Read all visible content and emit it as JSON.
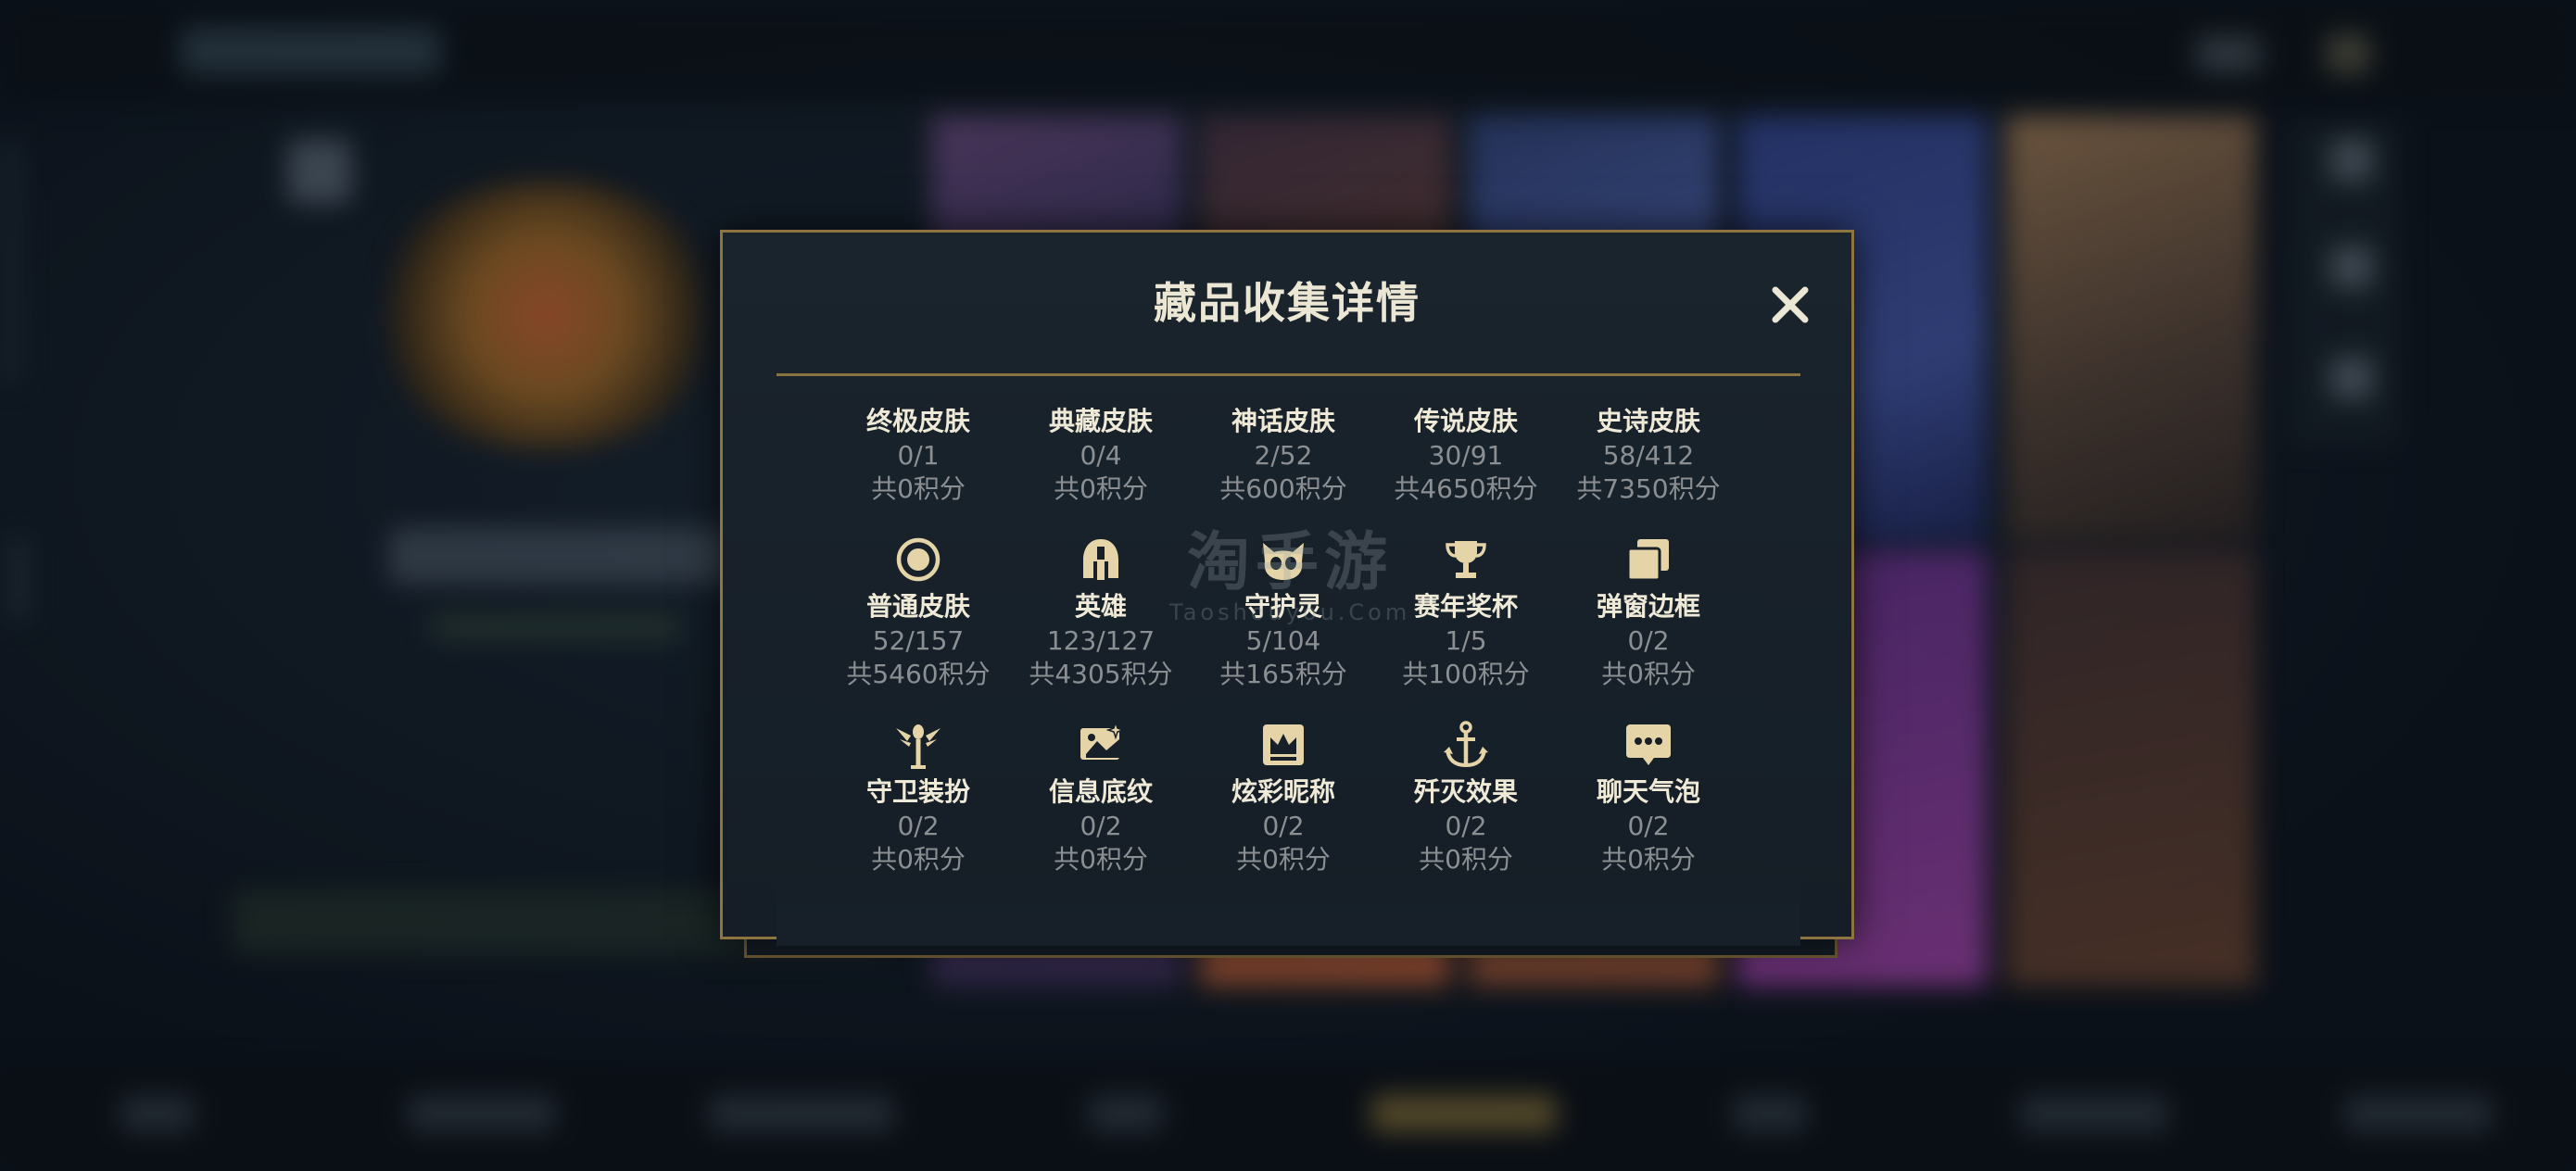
{
  "modal": {
    "title": "藏品收集详情",
    "close_icon": "close-icon"
  },
  "watermark": {
    "main": "淘手游",
    "sub": "Taoshouyou.Com"
  },
  "colors": {
    "accent_gold": "#8d7440",
    "icon_gold": "#e4d4a8",
    "title_text": "#ece6d4",
    "muted_text": "#8b8f92",
    "modal_bg": "#172028"
  },
  "items": [
    {
      "name": "终极皮肤",
      "count": "0/1",
      "points": "共0积分",
      "icon": null
    },
    {
      "name": "典藏皮肤",
      "count": "0/4",
      "points": "共0积分",
      "icon": null
    },
    {
      "name": "神话皮肤",
      "count": "2/52",
      "points": "共600积分",
      "icon": null
    },
    {
      "name": "传说皮肤",
      "count": "30/91",
      "points": "共4650积分",
      "icon": null
    },
    {
      "name": "史诗皮肤",
      "count": "58/412",
      "points": "共7350积分",
      "icon": null
    },
    {
      "name": "普通皮肤",
      "count": "52/157",
      "points": "共5460积分",
      "icon": "ring-icon"
    },
    {
      "name": "英雄",
      "count": "123/127",
      "points": "共4305积分",
      "icon": "helmet-icon"
    },
    {
      "name": "守护灵",
      "count": "5/104",
      "points": "共165积分",
      "icon": "pet-icon"
    },
    {
      "name": "赛年奖杯",
      "count": "1/5",
      "points": "共100积分",
      "icon": "trophy-icon"
    },
    {
      "name": "弹窗边框",
      "count": "0/2",
      "points": "共0积分",
      "icon": "frame-icon"
    },
    {
      "name": "守卫装扮",
      "count": "0/2",
      "points": "共0积分",
      "icon": "ward-icon"
    },
    {
      "name": "信息底纹",
      "count": "0/2",
      "points": "共0积分",
      "icon": "card-sparkle-icon"
    },
    {
      "name": "炫彩昵称",
      "count": "0/2",
      "points": "共0积分",
      "icon": "crown-badge-icon"
    },
    {
      "name": "歼灭效果",
      "count": "0/2",
      "points": "共0积分",
      "icon": "anchor-icon"
    },
    {
      "name": "聊天气泡",
      "count": "0/2",
      "points": "共0积分",
      "icon": "chat-bubble-icon"
    }
  ]
}
